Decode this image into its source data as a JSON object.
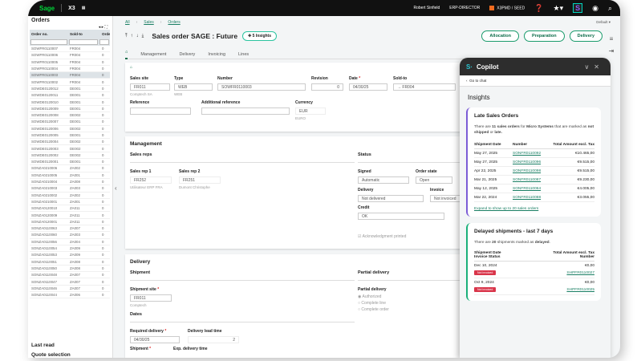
{
  "topbar": {
    "brand": "Sage",
    "product": "X3",
    "user": "Robert Sinfield",
    "role": "ERP-DIRECTOR",
    "folder": "X3PMD / SEED",
    "copilot_letter": "S"
  },
  "orders": {
    "title": "Orders",
    "columns": [
      "Order no.",
      "Sold-to",
      "Order d"
    ],
    "rows": [
      [
        "SOWFR0110007",
        "FR004"
      ],
      [
        "SOWFR0110006",
        "FR004"
      ],
      [
        "SOWFR0110005",
        "FR004"
      ],
      [
        "SOWFR0110004",
        "FR004"
      ],
      [
        "SOWFR0110003",
        "FR004"
      ],
      [
        "SOWFR0110002",
        "FR004"
      ],
      [
        "SOWDE0120012",
        "DE001"
      ],
      [
        "SOWDE0120011",
        "DE001"
      ],
      [
        "SOWDE0120010",
        "DE001"
      ],
      [
        "SOWDE0120009",
        "DE001"
      ],
      [
        "SOWDE0120008",
        "DE002"
      ],
      [
        "SOWDE0120007",
        "DE001"
      ],
      [
        "SOWDE0120006",
        "DE002"
      ],
      [
        "SOWDE0120005",
        "DE001"
      ],
      [
        "SOWDE0120004",
        "DE002"
      ],
      [
        "SOWDE0120003",
        "DE002"
      ],
      [
        "SOWDE0120002",
        "DE002"
      ],
      [
        "SOWDE0120001",
        "DE001"
      ],
      [
        "SONZA0210006",
        "ZA002"
      ],
      [
        "SONZA0210005",
        "ZA001"
      ],
      [
        "SONZA0210004",
        "ZA008"
      ],
      [
        "SONZA0210003",
        "ZA003"
      ],
      [
        "SONZA0210002",
        "ZA002"
      ],
      [
        "SONZA0210001",
        "ZA001"
      ],
      [
        "SONZA0120010",
        "ZA011"
      ],
      [
        "SONZA0120009",
        "ZA011"
      ],
      [
        "SONZA0120001",
        "ZA011"
      ],
      [
        "SONZA0110063",
        "ZA007"
      ],
      [
        "SONZA0110060",
        "ZA003"
      ],
      [
        "SONZA0110056",
        "ZA004"
      ],
      [
        "SONZA0110054",
        "ZA009"
      ],
      [
        "SONZA0110053",
        "ZA009"
      ],
      [
        "SONZA0110051",
        "ZA008"
      ],
      [
        "SONZA0110050",
        "ZA008"
      ],
      [
        "SONZA0110048",
        "ZA007"
      ],
      [
        "SONZA0110047",
        "ZA007"
      ],
      [
        "SONZA0110046",
        "ZA007"
      ],
      [
        "SONZA0110044",
        "ZA006"
      ]
    ],
    "selected_index": 4,
    "last_read": "Last read",
    "quote_selection": "Quote selection"
  },
  "breadcrumb": [
    "All",
    "Sales",
    "Orders"
  ],
  "page": {
    "title": "Sales order SAGE : Future",
    "insights": "5 Insights",
    "default": "Default"
  },
  "actions": [
    "Allocation",
    "Preparation",
    "Delivery"
  ],
  "tabs": [
    "Management",
    "Delivery",
    "Invoicing",
    "Lines"
  ],
  "header": {
    "sales_site": {
      "label": "Sales site",
      "value": "FR011",
      "sub": "Comptech SA"
    },
    "type": {
      "label": "Type",
      "value": "WEB",
      "sub": "WEB"
    },
    "number": {
      "label": "Number",
      "value": "SOWFR0110003"
    },
    "revision": {
      "label": "Revision",
      "value": "0"
    },
    "date": {
      "label": "Date",
      "value": "04/30/25"
    },
    "sold_to": {
      "label": "Sold-to",
      "value": "FR004"
    },
    "reference": {
      "label": "Reference",
      "value": ""
    },
    "additional_reference": {
      "label": "Additional reference",
      "value": ""
    },
    "currency": {
      "label": "Currency",
      "value": "EUR",
      "sub": "EURO"
    }
  },
  "management": {
    "title": "Management",
    "sales_reps": "Sales reps",
    "rep1": {
      "label": "Sales rep 1",
      "value": "FR252",
      "sub": "Utilisateur ERP FRA"
    },
    "rep2": {
      "label": "Sales rep 2",
      "value": "FR251",
      "sub": "Dumont Christophe"
    },
    "status": "Status",
    "signed": {
      "label": "Signed",
      "value": "Automatic"
    },
    "order_state": {
      "label": "Order state",
      "value": "Open"
    },
    "delivery": {
      "label": "Delivery",
      "value": "Not delivered"
    },
    "invoice": {
      "label": "Invoice",
      "value": "Not invoiced"
    },
    "credit": {
      "label": "Credit",
      "value": "OK"
    },
    "ack": "Acknowledgment printed"
  },
  "delivery": {
    "title": "Delivery",
    "shipment": "Shipment",
    "shipment_site": {
      "label": "Shipment site",
      "value": "FR011",
      "sub": "Comptech"
    },
    "dates": "Dates",
    "required_delivery": {
      "label": "Required delivery",
      "value": "04/30/25"
    },
    "lead_time": {
      "label": "Delivery lead time",
      "value": "2"
    },
    "shipment_date": {
      "label": "Shipment"
    },
    "exp_time": {
      "label": "Exp. delivery time"
    },
    "partial": "Partial delivery",
    "partial_label": "Partial delivery",
    "options": [
      "Authorized",
      "Complete line",
      "Complete order"
    ],
    "selected_option": "Authorized"
  },
  "copilot": {
    "title": "Copilot",
    "go_to_chat": "Go to chat",
    "insights": "Insights",
    "late": {
      "title": "Late Sales Orders",
      "text_pre": "There are ",
      "count": "11 sales orders",
      "text_mid": " for ",
      "customer": "Micro Systems",
      "text_mid2": " that are marked as ",
      "s1": "not shipped",
      "or": " or ",
      "s2": "late.",
      "cols": [
        "Shipment Date",
        "Number",
        "Total Amount excl. Tax"
      ],
      "rows": [
        [
          "May 27, 2025",
          "SONFR0110092",
          "€10.465,00"
        ],
        [
          "May 27, 2025",
          "SONFR0110096",
          "€9.515,00"
        ],
        [
          "Apr 22, 2025",
          "SONFR0110098",
          "€9.515,00"
        ],
        [
          "Mar 21, 2025",
          "SONFR0110087",
          "€9.230,00"
        ],
        [
          "May 12, 2025",
          "SONFR0110064",
          "€4.005,00"
        ],
        [
          "Mar 22, 2024",
          "SONFR0110088",
          "€3.055,00"
        ]
      ],
      "expand": "Expand to show up to 20 sales orders"
    },
    "delayed": {
      "title": "Delayed shipments - last 7 days",
      "text_pre": "There are ",
      "count": "20",
      "text_mid": " shipments marked as ",
      "status": "delayed",
      "end": ".",
      "cols": [
        "Shipment Date",
        "Total Amount excl. Tax",
        "Invoice Status",
        "Number"
      ],
      "rows": [
        [
          "Dec 10, 2024",
          "€0,00",
          "Not invoiced",
          "SHPFR0110027"
        ],
        [
          "Oct 9, 2024",
          "€0,00",
          "Not invoiced",
          "SHPFR0110025"
        ]
      ]
    }
  },
  "colors": {
    "accent": "#1a9b6c",
    "topbar": "#111111",
    "badge": "#d9354a"
  }
}
